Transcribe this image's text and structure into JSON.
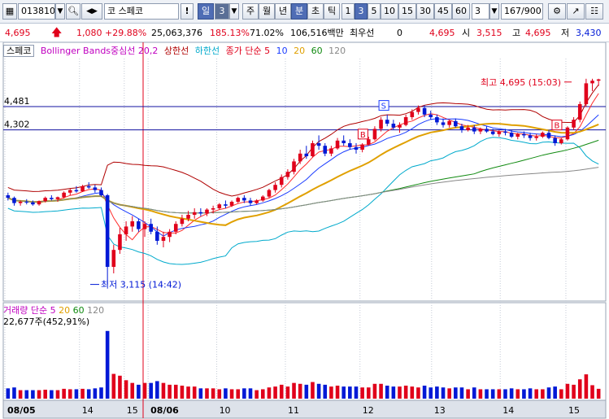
{
  "toolbar": {
    "stock_code": "013810",
    "stock_name": "코 스페코",
    "alert_label": "!",
    "period_day": "일",
    "period_count": "3",
    "period_week": "주",
    "period_month": "월",
    "period_year": "년",
    "period_minute": "분",
    "period_second": "초",
    "period_tick": "틱",
    "intervals": [
      "1",
      "3",
      "5",
      "10",
      "15",
      "30",
      "45",
      "60"
    ],
    "interval_select": "3",
    "view_counter": "167/900"
  },
  "quote": {
    "price": "4,695",
    "change": "1,080",
    "change_pct": "+29.88%",
    "volume": "25,063,376",
    "volume_ratio": "185.13%",
    "turnover": "71.02%",
    "amount": "106,516백만",
    "priority_label": "최우선",
    "priority_value": "0",
    "current_value": "4,695",
    "open_label": "시",
    "open_value": "3,515",
    "high_label": "고",
    "high_value": "4,695",
    "low_label": "저",
    "low_value": "3,430"
  },
  "legend": {
    "stock_name": "스페코",
    "bollinger": "Bollinger Bands중심선 20,2",
    "upper": "상한선",
    "lower": "하한선",
    "ma_label": "종가 단순 5",
    "ma10": "10",
    "ma20": "20",
    "ma60": "60",
    "ma120": "120"
  },
  "volume_legend": {
    "label": "거래량 단순 5",
    "ma20": "20",
    "ma60": "60",
    "ma120": "120",
    "current": "22,677주(452,91%)"
  },
  "colors": {
    "up": "#e0001b",
    "down": "#0019d6",
    "ma5": "#ff2a2a",
    "ma10": "#1a3cff",
    "ma20": "#e0a000",
    "ma60": "#108a10",
    "ma120": "#888888",
    "bollinger": "#b00000",
    "bb_lower": "#00aacc"
  },
  "chart_data": {
    "type": "candlestick",
    "ylim": [
      3000,
      4850
    ],
    "price_levels": [
      {
        "label": "4,481",
        "value": 4481
      },
      {
        "label": "4,302",
        "value": 4302
      }
    ],
    "high_annotation": {
      "text": "최고 4,695 (15:03)",
      "value": 4695
    },
    "low_annotation": {
      "text": "최저 3,115 (14:42)",
      "value": 3115
    },
    "x_ticks": [
      "08/05",
      "14",
      "15",
      "08/06",
      "10",
      "11",
      "12",
      "13",
      "14",
      "15"
    ],
    "x_tick_positions": [
      0.0,
      0.125,
      0.2,
      0.24,
      0.355,
      0.47,
      0.595,
      0.715,
      0.83,
      0.94
    ],
    "markers": [
      {
        "label": "S",
        "index": 0.635,
        "value": 4490
      },
      {
        "label": "B",
        "index": 0.6,
        "value": 4270
      },
      {
        "label": "B",
        "index": 0.925,
        "value": 4340
      }
    ],
    "candles": [
      [
        3800,
        3820,
        3760,
        3780
      ],
      [
        3780,
        3790,
        3720,
        3740
      ],
      [
        3740,
        3760,
        3720,
        3750
      ],
      [
        3750,
        3770,
        3730,
        3745
      ],
      [
        3745,
        3760,
        3720,
        3730
      ],
      [
        3730,
        3760,
        3720,
        3755
      ],
      [
        3755,
        3790,
        3745,
        3780
      ],
      [
        3780,
        3800,
        3760,
        3770
      ],
      [
        3770,
        3790,
        3750,
        3785
      ],
      [
        3785,
        3830,
        3775,
        3820
      ],
      [
        3820,
        3850,
        3800,
        3840
      ],
      [
        3840,
        3870,
        3820,
        3830
      ],
      [
        3830,
        3880,
        3825,
        3870
      ],
      [
        3870,
        3900,
        3850,
        3860
      ],
      [
        3860,
        3880,
        3820,
        3840
      ],
      [
        3840,
        3860,
        3790,
        3800
      ],
      [
        3800,
        3810,
        3115,
        3250
      ],
      [
        3250,
        3420,
        3200,
        3380
      ],
      [
        3380,
        3550,
        3350,
        3500
      ],
      [
        3500,
        3600,
        3450,
        3560
      ],
      [
        3560,
        3640,
        3520,
        3600
      ],
      [
        3600,
        3620,
        3520,
        3540
      ],
      [
        3540,
        3600,
        3480,
        3580
      ],
      [
        3580,
        3620,
        3500,
        3520
      ],
      [
        3520,
        3560,
        3420,
        3450
      ],
      [
        3450,
        3520,
        3400,
        3480
      ],
      [
        3480,
        3540,
        3440,
        3520
      ],
      [
        3520,
        3600,
        3500,
        3580
      ],
      [
        3580,
        3650,
        3560,
        3620
      ],
      [
        3620,
        3680,
        3600,
        3650
      ],
      [
        3650,
        3700,
        3620,
        3670
      ],
      [
        3670,
        3700,
        3640,
        3660
      ],
      [
        3660,
        3700,
        3640,
        3690
      ],
      [
        3690,
        3720,
        3660,
        3700
      ],
      [
        3700,
        3740,
        3690,
        3730
      ],
      [
        3730,
        3760,
        3700,
        3720
      ],
      [
        3720,
        3760,
        3710,
        3750
      ],
      [
        3750,
        3790,
        3740,
        3780
      ],
      [
        3780,
        3800,
        3740,
        3760
      ],
      [
        3760,
        3780,
        3720,
        3740
      ],
      [
        3740,
        3770,
        3730,
        3760
      ],
      [
        3760,
        3800,
        3750,
        3790
      ],
      [
        3790,
        3850,
        3780,
        3840
      ],
      [
        3840,
        3900,
        3820,
        3880
      ],
      [
        3880,
        3960,
        3860,
        3940
      ],
      [
        3940,
        4000,
        3920,
        3980
      ],
      [
        3980,
        4080,
        3960,
        4060
      ],
      [
        4060,
        4150,
        4040,
        4120
      ],
      [
        4120,
        4180,
        4080,
        4100
      ],
      [
        4100,
        4220,
        4090,
        4200
      ],
      [
        4200,
        4260,
        4150,
        4180
      ],
      [
        4180,
        4200,
        4100,
        4120
      ],
      [
        4120,
        4180,
        4100,
        4160
      ],
      [
        4160,
        4240,
        4150,
        4220
      ],
      [
        4220,
        4260,
        4180,
        4200
      ],
      [
        4200,
        4230,
        4150,
        4170
      ],
      [
        4170,
        4200,
        4120,
        4150
      ],
      [
        4150,
        4200,
        4130,
        4190
      ],
      [
        4190,
        4250,
        4180,
        4230
      ],
      [
        4230,
        4330,
        4220,
        4310
      ],
      [
        4310,
        4400,
        4290,
        4380
      ],
      [
        4380,
        4420,
        4330,
        4350
      ],
      [
        4350,
        4380,
        4300,
        4320
      ],
      [
        4320,
        4360,
        4280,
        4340
      ],
      [
        4340,
        4420,
        4330,
        4400
      ],
      [
        4400,
        4460,
        4380,
        4440
      ],
      [
        4440,
        4490,
        4420,
        4470
      ],
      [
        4470,
        4490,
        4400,
        4420
      ],
      [
        4420,
        4450,
        4380,
        4400
      ],
      [
        4400,
        4420,
        4340,
        4360
      ],
      [
        4360,
        4390,
        4320,
        4340
      ],
      [
        4340,
        4380,
        4320,
        4370
      ],
      [
        4370,
        4390,
        4320,
        4330
      ],
      [
        4330,
        4350,
        4280,
        4300
      ],
      [
        4300,
        4340,
        4290,
        4320
      ],
      [
        4320,
        4340,
        4270,
        4290
      ],
      [
        4290,
        4320,
        4270,
        4310
      ],
      [
        4310,
        4330,
        4280,
        4290
      ],
      [
        4290,
        4310,
        4260,
        4270
      ],
      [
        4270,
        4300,
        4250,
        4290
      ],
      [
        4290,
        4310,
        4260,
        4280
      ],
      [
        4280,
        4300,
        4240,
        4250
      ],
      [
        4250,
        4280,
        4230,
        4270
      ],
      [
        4270,
        4290,
        4240,
        4260
      ],
      [
        4260,
        4280,
        4220,
        4240
      ],
      [
        4240,
        4270,
        4220,
        4250
      ],
      [
        4250,
        4290,
        4240,
        4280
      ],
      [
        4280,
        4300,
        4230,
        4240
      ],
      [
        4240,
        4260,
        4180,
        4200
      ],
      [
        4200,
        4240,
        4190,
        4230
      ],
      [
        4230,
        4330,
        4220,
        4320
      ],
      [
        4320,
        4400,
        4300,
        4380
      ],
      [
        4380,
        4520,
        4360,
        4500
      ],
      [
        4500,
        4695,
        4480,
        4660
      ],
      [
        4660,
        4695,
        4600,
        4680
      ],
      [
        4680,
        4695,
        4640,
        4690
      ]
    ]
  }
}
